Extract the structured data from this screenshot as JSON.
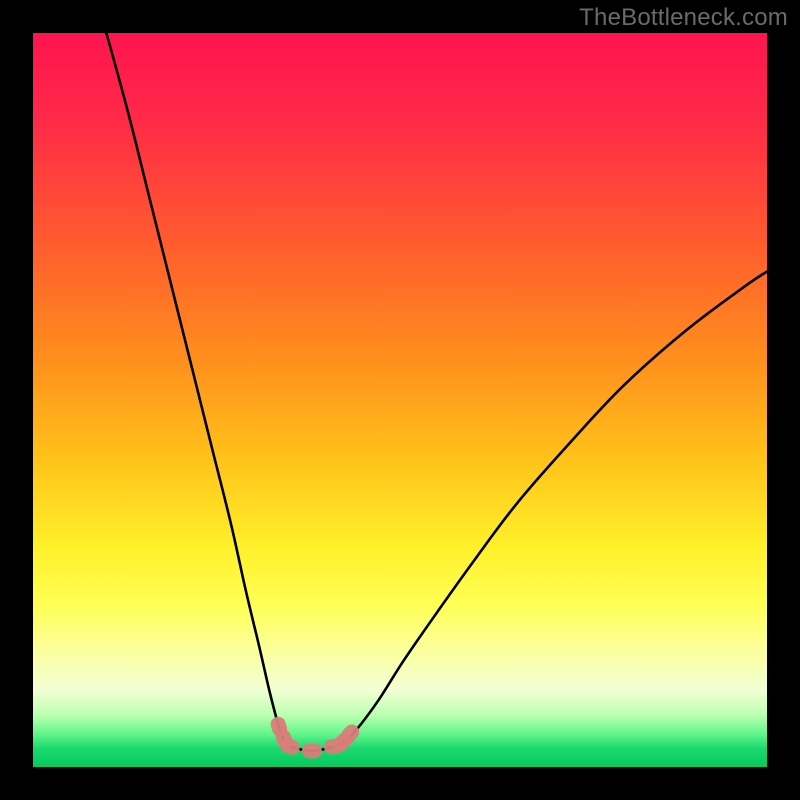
{
  "attribution": "TheBottleneck.com",
  "colors": {
    "gradient_stops": [
      {
        "offset": 0.0,
        "color": "#ff1450"
      },
      {
        "offset": 0.12,
        "color": "#ff2a47"
      },
      {
        "offset": 0.28,
        "color": "#ff5a2f"
      },
      {
        "offset": 0.44,
        "color": "#ff8d1d"
      },
      {
        "offset": 0.58,
        "color": "#ffc21a"
      },
      {
        "offset": 0.7,
        "color": "#fff02a"
      },
      {
        "offset": 0.78,
        "color": "#ffff55"
      },
      {
        "offset": 0.84,
        "color": "#fbff9b"
      },
      {
        "offset": 0.895,
        "color": "#f2ffd4"
      },
      {
        "offset": 0.93,
        "color": "#b9ffb0"
      },
      {
        "offset": 0.955,
        "color": "#63f58b"
      },
      {
        "offset": 0.975,
        "color": "#1bd96e"
      },
      {
        "offset": 1.0,
        "color": "#07c95e"
      }
    ],
    "marker": "#d97d78",
    "curve": "#000000",
    "frame": "#000000"
  },
  "chart_data": {
    "type": "line",
    "title": "",
    "xlabel": "",
    "ylabel": "",
    "xlim": [
      0,
      100
    ],
    "ylim": [
      0,
      100
    ],
    "grid": false,
    "legend": false,
    "note": "Axes are unlabeled in the source image. x is a normalized horizontal position (0 = left, 100 = right). y is a normalized curve height (0 = bottom/green zone, 100 = top/red zone). Values estimated from pixel positions.",
    "series": [
      {
        "name": "left-branch",
        "x": [
          10.0,
          13.0,
          16.0,
          19.0,
          22.0,
          24.5,
          27.0,
          29.0,
          30.8,
          32.3,
          33.5,
          34.5
        ],
        "y": [
          100.0,
          89.0,
          77.0,
          65.0,
          53.0,
          43.0,
          33.0,
          24.0,
          16.5,
          10.0,
          5.5,
          3.0
        ]
      },
      {
        "name": "valley-floor",
        "x": [
          34.5,
          36.0,
          38.0,
          40.0,
          42.0
        ],
        "y": [
          3.0,
          2.5,
          2.2,
          2.5,
          3.0
        ]
      },
      {
        "name": "right-branch",
        "x": [
          42.0,
          44.0,
          47.0,
          50.5,
          55.0,
          60.0,
          66.0,
          73.0,
          80.5,
          89.0,
          97.0,
          100.0
        ],
        "y": [
          3.0,
          5.0,
          9.0,
          14.5,
          21.0,
          28.0,
          36.0,
          44.0,
          52.0,
          59.5,
          65.5,
          67.5
        ]
      }
    ],
    "markers": {
      "comment": "Pink capsule markers where the curve enters the bottom green band.",
      "points": [
        {
          "series": "left-branch",
          "x": 33.5,
          "y": 5.5
        },
        {
          "series": "left-branch",
          "x": 34.2,
          "y": 3.8
        },
        {
          "series": "valley-floor",
          "x": 35.0,
          "y": 2.8
        },
        {
          "series": "valley-floor",
          "x": 38.0,
          "y": 2.2
        },
        {
          "series": "valley-floor",
          "x": 41.0,
          "y": 2.8
        },
        {
          "series": "right-branch",
          "x": 42.2,
          "y": 3.4
        },
        {
          "series": "right-branch",
          "x": 43.2,
          "y": 4.5
        }
      ]
    }
  }
}
